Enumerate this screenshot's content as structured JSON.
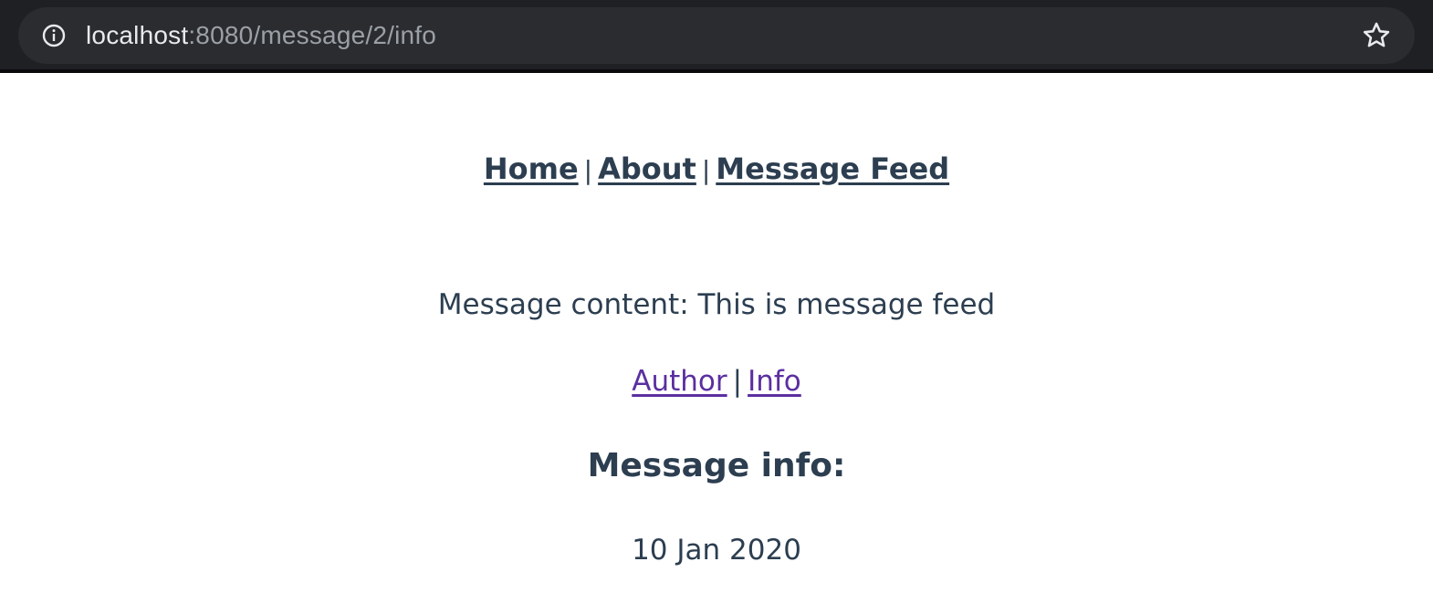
{
  "browser": {
    "url_host": "localhost",
    "url_rest": ":8080/message/2/info",
    "info_icon": "info-icon",
    "bookmark_icon": "star-icon"
  },
  "nav": {
    "items": [
      {
        "label": "Home"
      },
      {
        "label": "About"
      },
      {
        "label": "Message Feed"
      }
    ],
    "separator": "|"
  },
  "message": {
    "content_line": "Message content: This is message feed",
    "links": [
      {
        "label": "Author"
      },
      {
        "label": "Info"
      }
    ],
    "separator": "|",
    "info_heading": "Message info:",
    "date": "10 Jan 2020"
  },
  "colors": {
    "text": "#2c3e50",
    "link_visited": "#5b2fa0",
    "browser_bar": "#1f2023"
  }
}
